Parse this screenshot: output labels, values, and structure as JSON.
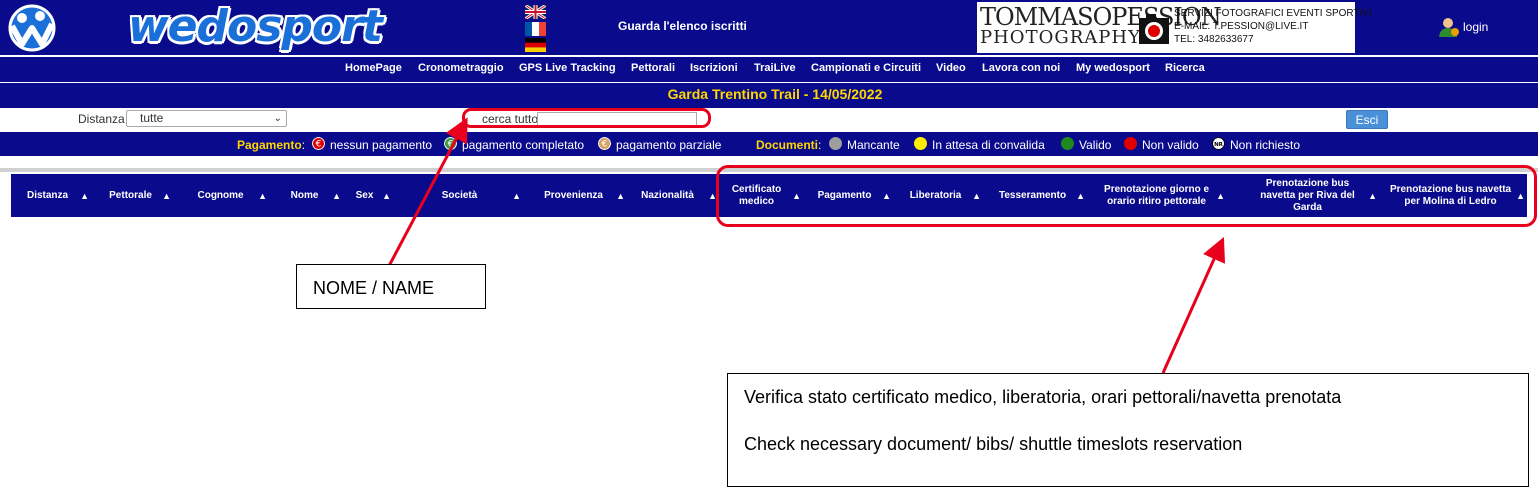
{
  "header": {
    "brand": "wedosport",
    "guarda_link": "Guarda l'elenco iscritti",
    "photographer": {
      "name_line1": "TOMMASOPESSION",
      "name_line2": "PHOTOGRAPHY",
      "info_line1": "SERVIZI FOTOGRAFICI EVENTI SPORTIVI",
      "info_line2": "E-MAIL: T.PESSION@LIVE.IT",
      "info_line3": "TEL: 3482633677"
    },
    "login": "login"
  },
  "menu": [
    "HomePage",
    "Cronometraggio",
    "GPS Live Tracking",
    "Pettorali",
    "Iscrizioni",
    "TraiLive",
    "Campionati e Circuiti",
    "Video",
    "Lavora con noi",
    "My wedosport",
    "Ricerca"
  ],
  "event_title": "Garda Trentino Trail - 14/05/2022",
  "filters": {
    "distanza_label": "Distanza",
    "distanza_value": "tutte",
    "search_label": "cerca tutto",
    "search_value": "",
    "esci": "Esci"
  },
  "legend": {
    "pagamento_key": "Pagamento",
    "pagamento": [
      "nessun pagamento",
      "pagamento completato",
      "pagamento parziale"
    ],
    "documenti_key": "Documenti",
    "documenti": [
      "Mancante",
      "In attesa di convalida",
      "Valido",
      "Non valido",
      "Non richiesto"
    ],
    "nr_badge": "NR",
    "colors": {
      "mancante": "#9e9e9e",
      "in_attesa": "#ffee00",
      "valido": "#1e8a1e",
      "non_valido": "#e00000",
      "non_richiesto": "#ffffff"
    }
  },
  "table": {
    "columns": [
      "Distanza",
      "Pettorale",
      "Cognome",
      "Nome",
      "Sex",
      "Società",
      "Provenienza",
      "Nazionalità",
      "Certificato medico",
      "Pagamento",
      "Liberatoria",
      "Tesseramento",
      "Prenotazione giorno e orario ritiro pettorale",
      "Prenotazione bus navetta per Riva del Garda",
      "Prenotazione bus navetta per Molina di Ledro"
    ]
  },
  "annotations": {
    "name_box": "NOME / NAME",
    "check_line1": "Verifica stato certificato medico, liberatoria, orari pettorali/navetta prenotata",
    "check_line2": "Check necessary document/ bibs/ shuttle timeslots reservation"
  },
  "theme": {
    "navy": "#0a0a8c",
    "title_yellow": "#ffd700",
    "highlight_red": "#e8001c",
    "button_blue": "#4a90d9"
  }
}
